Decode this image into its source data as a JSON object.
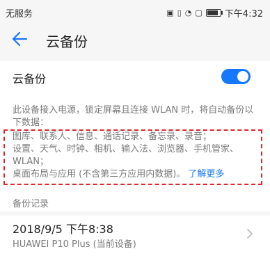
{
  "status_bar": {
    "carrier": "无服务",
    "time": "下午4:32",
    "icons": [
      "nfc-icon",
      "vibrate-icon",
      "wifi-icon",
      "sim-icon",
      "battery-icon"
    ]
  },
  "header": {
    "title": "云备份",
    "back_icon": "arrow-left-icon"
  },
  "toggle": {
    "label": "云备份",
    "state": "on",
    "accent": "#1677ff"
  },
  "description": {
    "line1": "此设备接入电源，锁定屏幕且连接 WLAN 时，将自动备份以下数据：",
    "items_line1": "图库、联系人、信息、通话记录、备忘录、录音；",
    "items_line2": "设置、天气、时钟、相机、输入法、浏览器、手机管家、WLAN；",
    "items_line3": "桌面布局与应用 (不含第三方应用内数据)。",
    "learn_more": "了解更多"
  },
  "backup_records": {
    "section_title": "备份记录",
    "items": [
      {
        "date": "2018/9/5 下午8:38",
        "device": "HUAWEI P10 Plus (当前设备)"
      }
    ]
  },
  "colors": {
    "highlight_border": "#e0262b",
    "link": "#1677ff"
  }
}
